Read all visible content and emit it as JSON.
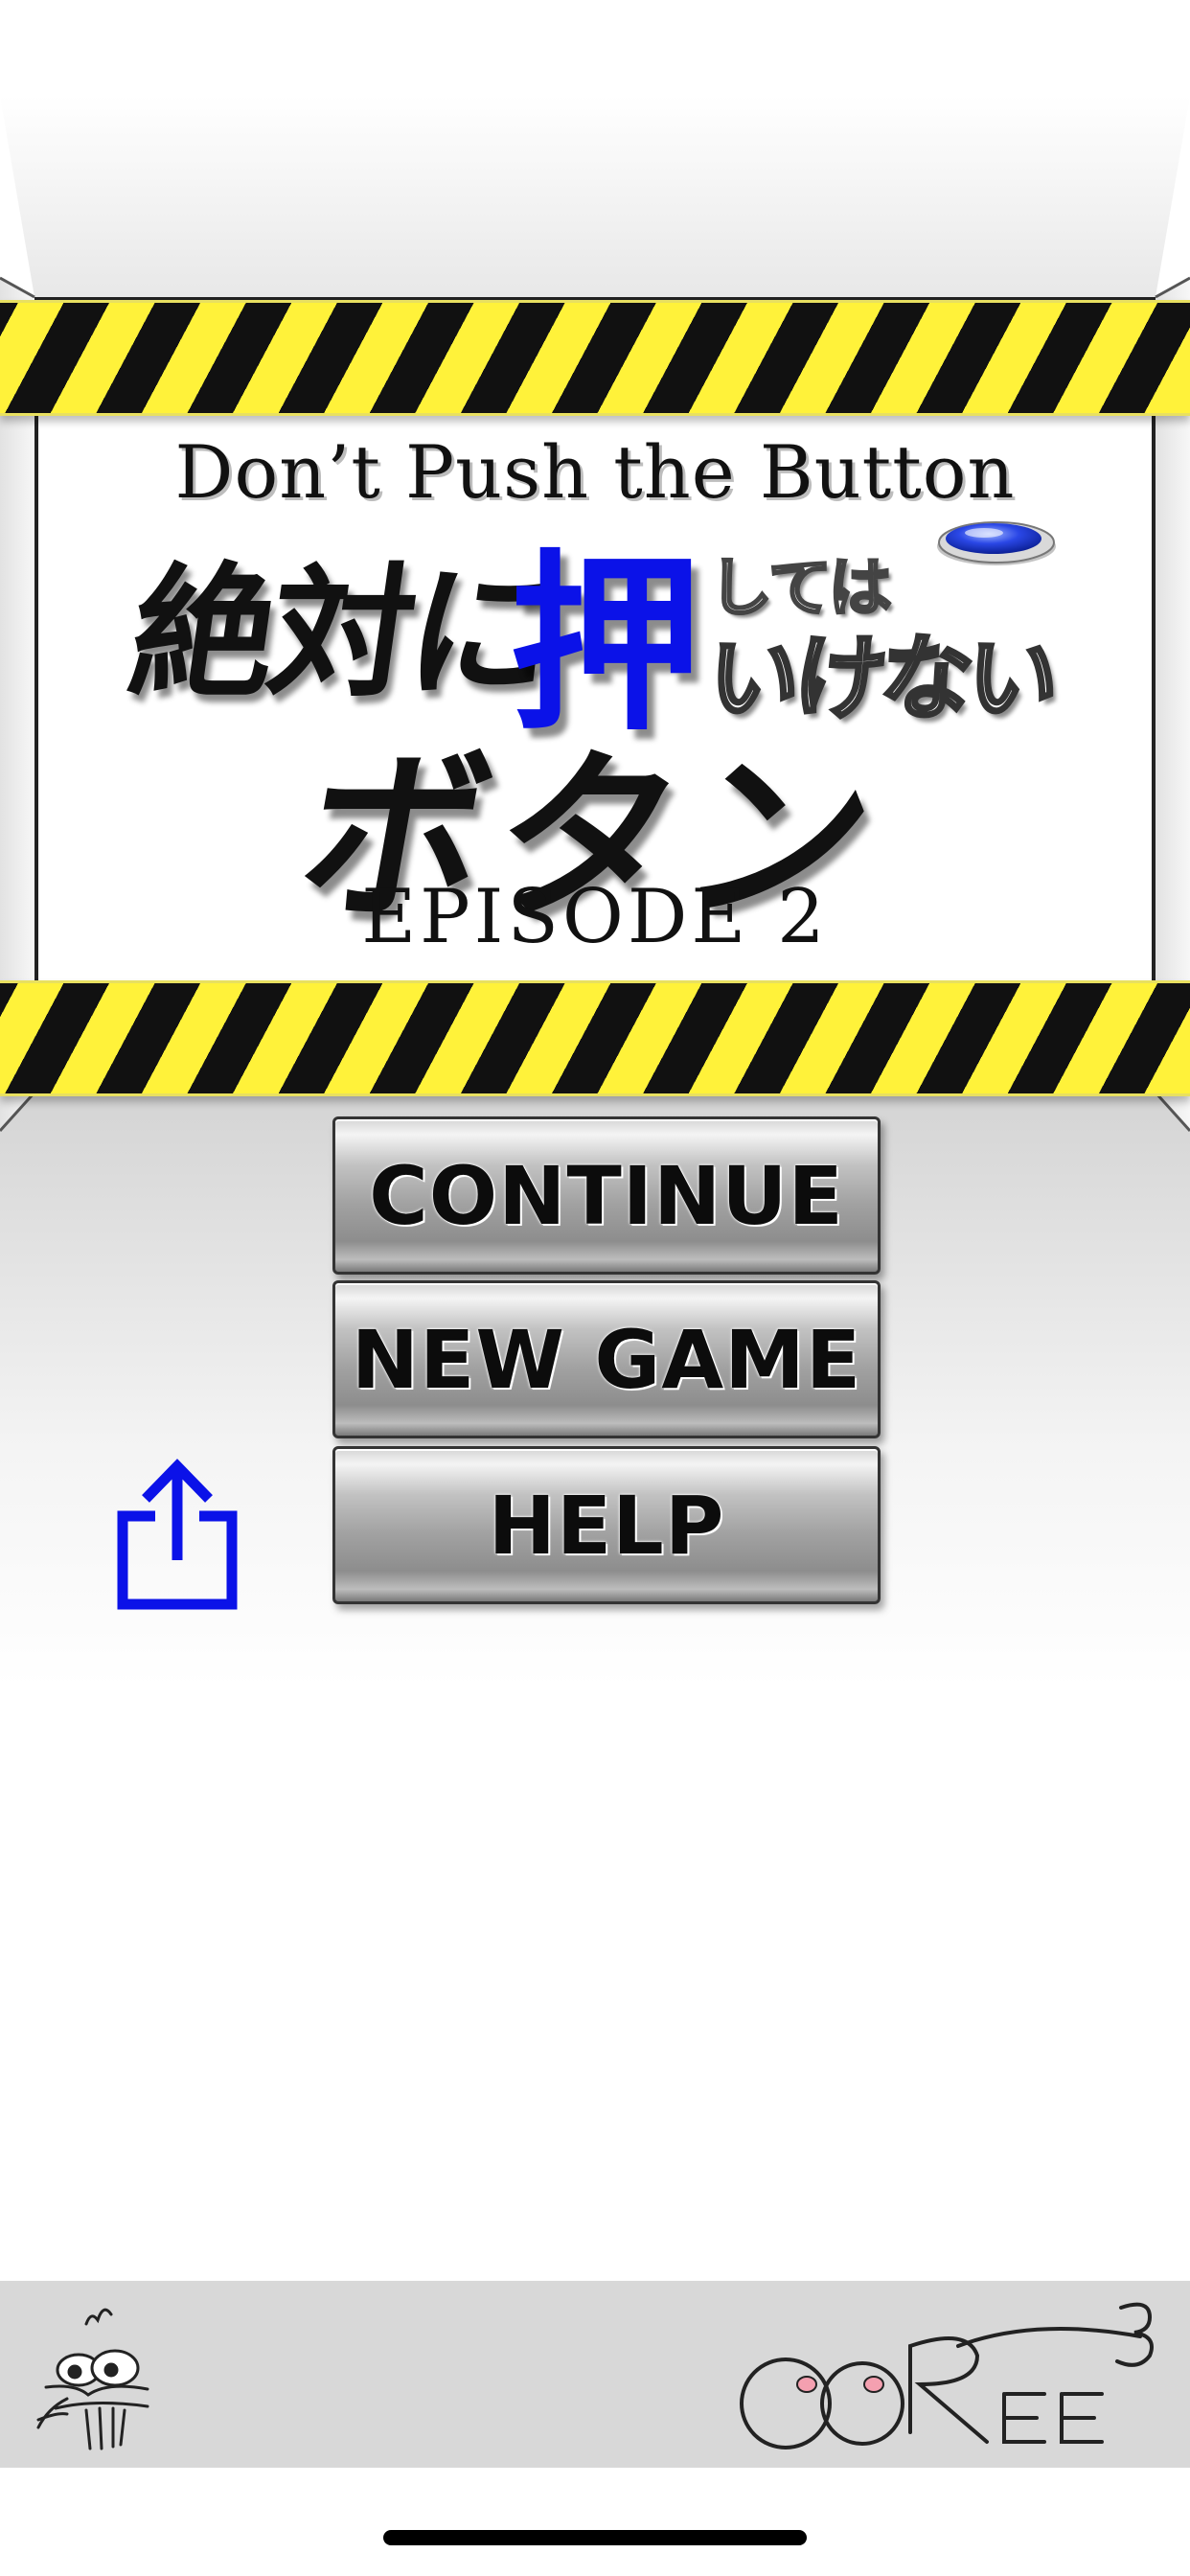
{
  "title": {
    "english": "Don’t Push the Button",
    "japanese_prefix": "絶対に",
    "japanese_kanji": "押",
    "japanese_small": "しては",
    "japanese_ikenai": "いけない",
    "japanese_botan": "ボタン",
    "episode": "EPISODE 2"
  },
  "menu": {
    "continue_label": "CONTINUE",
    "new_game_label": "NEW GAME",
    "help_label": "HELP"
  },
  "icons": {
    "share": "share-icon",
    "left_logo": "bug-character-logo",
    "right_logo": "ootree-logo"
  },
  "colors": {
    "tape_yellow": "#fff23a",
    "tape_black": "#111111",
    "accent_blue": "#0b12e8",
    "footer_gray": "#d8d8d8"
  }
}
